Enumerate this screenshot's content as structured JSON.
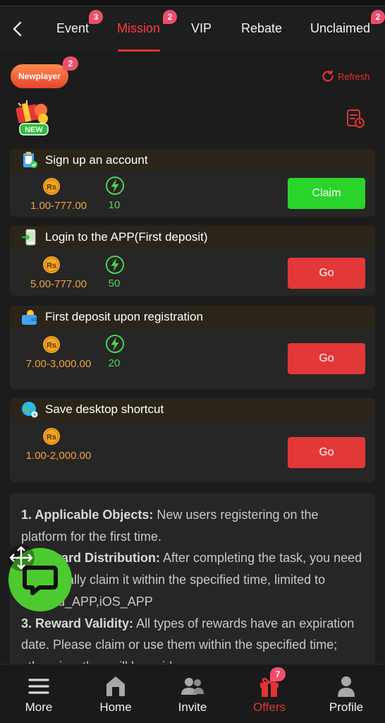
{
  "tabs": {
    "items": [
      {
        "label": "Event",
        "badge": "3"
      },
      {
        "label": "Mission",
        "badge": "2",
        "active": true
      },
      {
        "label": "VIP"
      },
      {
        "label": "Rebate"
      },
      {
        "label": "Unclaimed",
        "badge": "2"
      }
    ]
  },
  "header": {
    "newplayer_label": "Newplayer",
    "newplayer_badge": "2",
    "refresh_label": "Refresh",
    "new_badge_text": "NEW"
  },
  "tasks": [
    {
      "title": "Sign up an account",
      "amount": "1.00-777.00",
      "points": "10",
      "action": "Claim"
    },
    {
      "title": "Login to the APP(First deposit)",
      "amount": "5.00-777.00",
      "points": "50",
      "action": "Go"
    },
    {
      "title": "First deposit upon registration",
      "amount": "7.00-3,000.00",
      "points": "20",
      "action": "Go"
    },
    {
      "title": "Save desktop shortcut",
      "amount": "1.00-2,000.00",
      "action": "Go"
    }
  ],
  "currency_symbol": "Rs",
  "rules": {
    "item1_label": "1. Applicable Objects:",
    "item1_text": " New users registering on the platform for the first time.",
    "item2_label": "2. Reward Distribution:",
    "item2_text": " After completing the task, you need to manually claim it within the specified time, limited to Android_APP,iOS_APP",
    "item3_label": "3. Reward Validity:",
    "item3_text": " All types of rewards have an expiration date. Please claim or use them within the specified time; otherwise, they will be void."
  },
  "bottom_nav": {
    "items": [
      {
        "label": "More",
        "icon": "menu-icon"
      },
      {
        "label": "Home",
        "icon": "home-icon"
      },
      {
        "label": "Invite",
        "icon": "users-icon"
      },
      {
        "label": "Offers",
        "icon": "gift-icon",
        "active": true,
        "badge": "7"
      },
      {
        "label": "Profile",
        "icon": "profile-icon"
      }
    ]
  },
  "colors": {
    "accent": "#e23434",
    "claim_green": "#2ad42a",
    "go_red": "#e33838",
    "coin_orange": "#f0a33a",
    "points_green": "#4fd44f",
    "background": "#1c1c1c"
  }
}
